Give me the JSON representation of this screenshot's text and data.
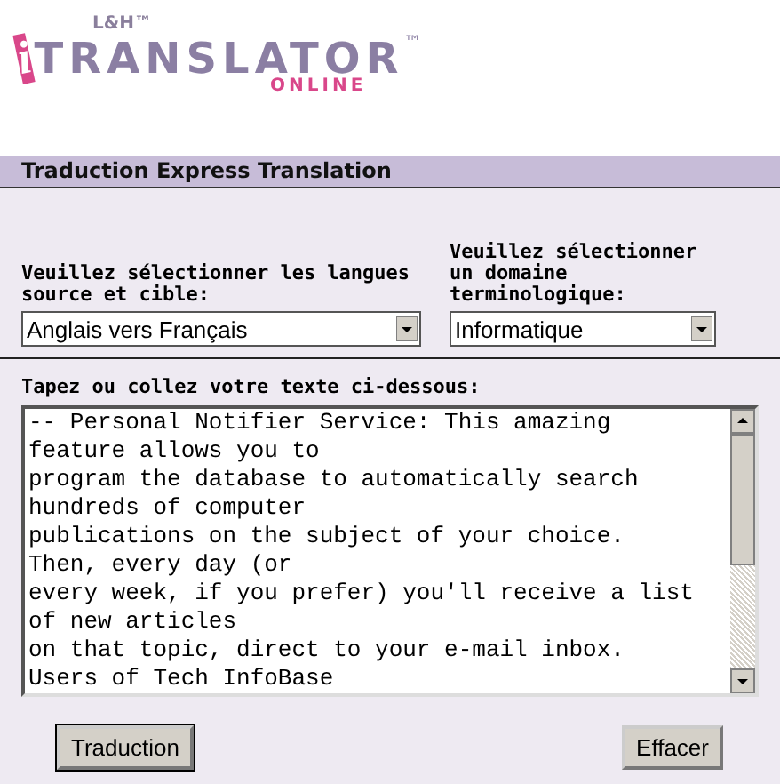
{
  "logo": {
    "company": "L&H™",
    "letter": "i",
    "name": "TRANSLATOR",
    "trademark": "™",
    "tagline": "ONLINE"
  },
  "section_title": "Traduction Express Translation",
  "language": {
    "label": "Veuillez sélectionner les langues source et cible:",
    "value": "Anglais vers Français"
  },
  "domain": {
    "label": "Veuillez sélectionner un domaine terminologique:",
    "value": "Informatique"
  },
  "input": {
    "label": "Tapez ou collez votre texte ci-dessous:",
    "value": "-- Personal Notifier Service: This amazing\nfeature allows you to\nprogram the database to automatically search\nhundreds of computer\npublications on the subject of your choice.\nThen, every day (or\nevery week, if you prefer) you'll receive a list\nof new articles\non that topic, direct to your e-mail inbox.\nUsers of Tech InfoBase"
  },
  "buttons": [
    {
      "label": "Traduction",
      "focused": true
    },
    {
      "label": "Effacer",
      "focused": false
    }
  ]
}
